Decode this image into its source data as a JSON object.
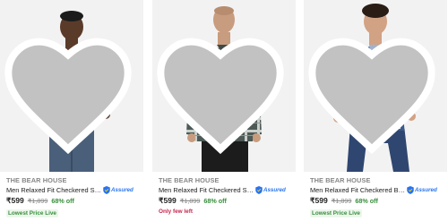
{
  "products": [
    {
      "brand": "THE BEAR HOUSE",
      "title": "Men Relaxed Fit Checkered Spre...",
      "assured": "Assured",
      "price": "₹599",
      "mrp": "₹1,899",
      "discount": "68% off",
      "tag": "Lowest Price Live",
      "tag_type": "green"
    },
    {
      "brand": "THE BEAR HOUSE",
      "title": "Men Relaxed Fit Checkered Spre...",
      "assured": "Assured",
      "price": "₹599",
      "mrp": "₹1,899",
      "discount": "68% off",
      "tag": "Only few left",
      "tag_type": "red"
    },
    {
      "brand": "THE BEAR HOUSE",
      "title": "Men Relaxed Fit Checkered Butt...",
      "assured": "Assured",
      "price": "₹599",
      "mrp": "₹1,899",
      "discount": "68% off",
      "tag": "Lowest Price Live",
      "tag_type": "green"
    }
  ],
  "icons": {
    "wishlist": "heart-icon",
    "assured": "shield-icon"
  },
  "colors": {
    "discount": "#388e3c",
    "assured_blue": "#2874f0",
    "few_left": "#c7254e",
    "muted_text": "#878787"
  }
}
